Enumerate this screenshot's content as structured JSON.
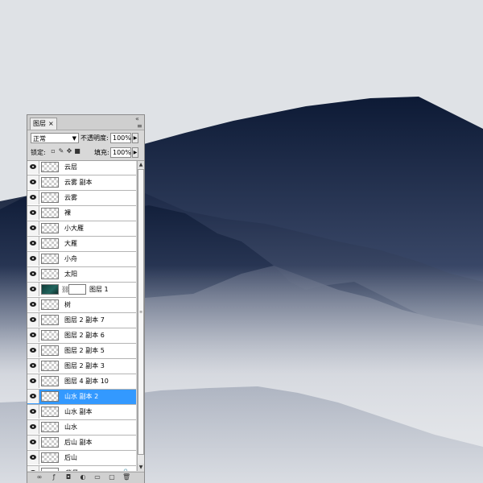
{
  "panel": {
    "tab_label": "图层",
    "tab_close": "×",
    "collapse_icon": "«",
    "menu_icon": "≡",
    "blend_mode": "正常",
    "opacity_label": "不透明度:",
    "opacity_value": "100%",
    "lock_label": "锁定:",
    "fill_label": "填充:",
    "fill_value": "100%",
    "layers": [
      {
        "name": "云层",
        "thumb": "transparent",
        "selected": false
      },
      {
        "name": "云雾 副本",
        "thumb": "transparent",
        "selected": false
      },
      {
        "name": "云雾",
        "thumb": "transparent",
        "selected": false
      },
      {
        "name": "裸",
        "thumb": "transparent",
        "selected": false
      },
      {
        "name": "小大雁",
        "thumb": "transparent",
        "selected": false
      },
      {
        "name": "大雁",
        "thumb": "transparent",
        "selected": false
      },
      {
        "name": "小舟",
        "thumb": "transparent",
        "selected": false
      },
      {
        "name": "太阳",
        "thumb": "transparent",
        "selected": false
      },
      {
        "name": "图层 1",
        "thumb": "teal",
        "mask": true,
        "selected": false
      },
      {
        "name": "树",
        "thumb": "transparent",
        "selected": false
      },
      {
        "name": "图层 2 副本 7",
        "thumb": "transparent",
        "selected": false
      },
      {
        "name": "图层 2 副本 6",
        "thumb": "transparent",
        "selected": false
      },
      {
        "name": "图层 2 副本 5",
        "thumb": "transparent",
        "selected": false
      },
      {
        "name": "图层 2 副本 3",
        "thumb": "transparent",
        "selected": false
      },
      {
        "name": "图层 4 副本 10",
        "thumb": "transparent",
        "selected": false
      },
      {
        "name": "山水 副本 2",
        "thumb": "transparent",
        "selected": true
      },
      {
        "name": "山水 副本",
        "thumb": "transparent",
        "selected": false
      },
      {
        "name": "山水",
        "thumb": "transparent",
        "selected": false
      },
      {
        "name": "后山 副本",
        "thumb": "transparent",
        "selected": false
      },
      {
        "name": "后山",
        "thumb": "transparent",
        "selected": false
      },
      {
        "name": "背景",
        "thumb": "white",
        "italic": true,
        "locked": true,
        "selected": false
      }
    ]
  },
  "colors": {
    "sky": "#dfe2e6",
    "mountain_dark": "#0d1a33",
    "mountain_mid": "#4a5672",
    "mist": "#e6e8ec",
    "selection": "#3399ff"
  }
}
